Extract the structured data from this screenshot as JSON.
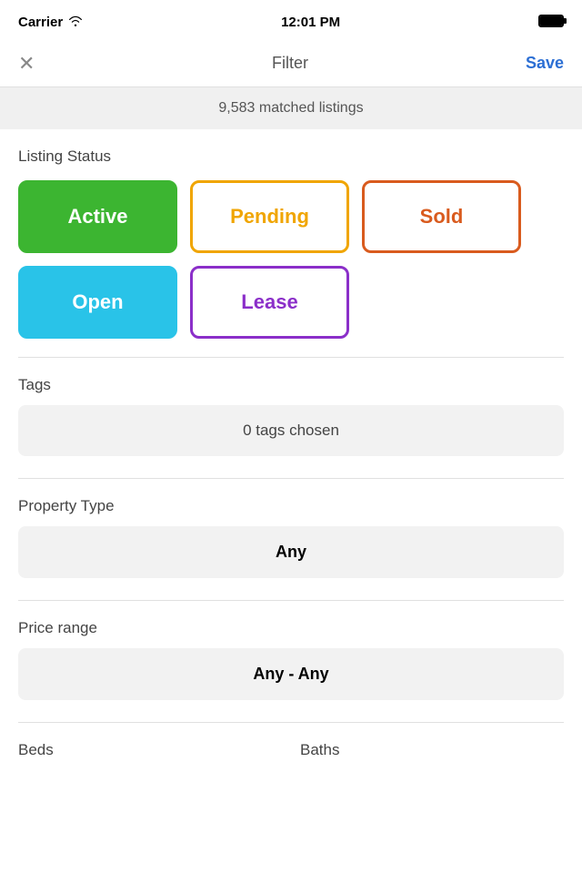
{
  "statusBar": {
    "carrier": "Carrier",
    "time": "12:01 PM"
  },
  "navBar": {
    "closeLabel": "✕",
    "title": "Filter",
    "saveLabel": "Save"
  },
  "matchedBanner": {
    "text": "9,583 matched listings"
  },
  "listingStatus": {
    "sectionTitle": "Listing Status",
    "buttons": [
      {
        "label": "Active",
        "style": "active-selected"
      },
      {
        "label": "Pending",
        "style": "pending"
      },
      {
        "label": "Sold",
        "style": "sold"
      },
      {
        "label": "Open",
        "style": "open-selected"
      },
      {
        "label": "Lease",
        "style": "lease"
      }
    ]
  },
  "tags": {
    "sectionTitle": "Tags",
    "buttonLabel": "0 tags chosen"
  },
  "propertyType": {
    "sectionTitle": "Property Type",
    "buttonLabel": "Any"
  },
  "priceRange": {
    "sectionTitle": "Price range",
    "buttonLabel": "Any - Any"
  },
  "bedsAndBaths": {
    "bedsLabel": "Beds",
    "bathsLabel": "Baths"
  }
}
